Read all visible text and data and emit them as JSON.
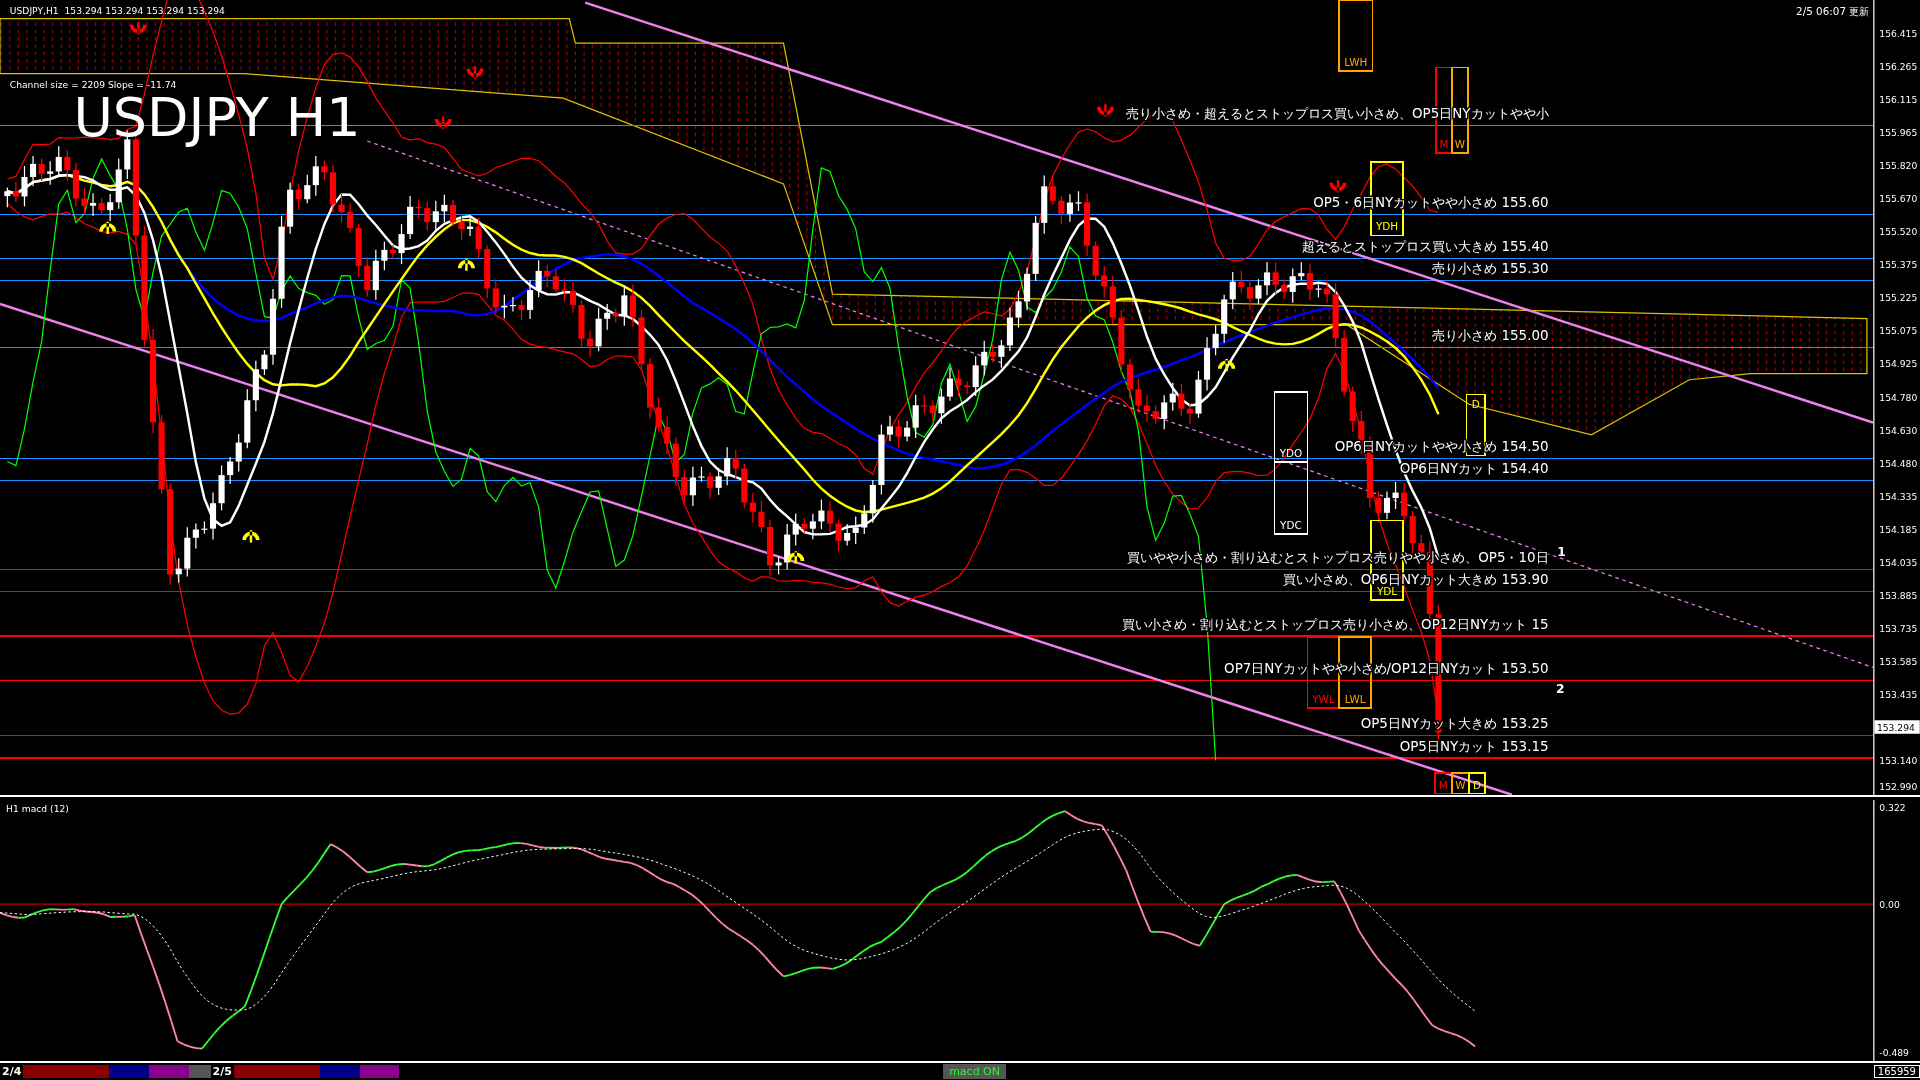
{
  "header": {
    "symbol": "USDJPY,H1",
    "prices": "153.294 153.294 153.294 153.294"
  },
  "channel_info": "Channel size = 2209 Slope = -11.74",
  "title": "USDJPY H1",
  "updated": "2/5 06:07 更新",
  "levels": [
    {
      "text": "売り小さめ・超えるとストップロス買い小さめ、OP5日NYカットやや小",
      "color": "#1e90ff"
    },
    {
      "text": "OP5・6日NYカットやや小さめ 155.60",
      "color": "#1e90ff"
    },
    {
      "text": "超えるとストップロス買い大きめ 155.40",
      "color": "#1e90ff"
    },
    {
      "text": "売り小さめ 155.30",
      "color": "#1e90ff"
    },
    {
      "text": "売り小さめ 155.00",
      "color": "#1e90ff"
    },
    {
      "text": "OP6日NYカットやや小さめ 154.50",
      "color": "#1e90ff"
    },
    {
      "text": "OP6日NYカット 154.40",
      "color": "#1e90ff"
    },
    {
      "text": "買いやや小さめ・割り込むとストップロス売りやや小さめ、OP5・10日",
      "color": "#ff0000"
    },
    {
      "text": "買い小さめ、OP6日NYカット大きめ 153.90",
      "color": "#ff0000"
    },
    {
      "text": "買い小さめ・割り込むとストップロス売り小さめ、OP12日NYカット 15",
      "color": "#ff0000"
    },
    {
      "text": "OP7日NYカットやや小さめ/OP12日NYカット 153.50",
      "color": "#ff0000"
    },
    {
      "text": "OP5日NYカット大きめ 153.25",
      "color": "#ff0000"
    },
    {
      "text": "OP5日NYカット 153.15",
      "color": "#ff0000"
    }
  ],
  "range_boxes": [
    {
      "label": "LWH",
      "color": "#ffa500"
    },
    {
      "label": "M",
      "color": "#ff0000"
    },
    {
      "label": "W",
      "color": "#ffa500"
    },
    {
      "label": "YDH",
      "color": "#ffff00"
    },
    {
      "label": "YDO",
      "color": "#ffffff"
    },
    {
      "label": "YDC",
      "color": "#ffffff"
    },
    {
      "label": "D",
      "color": "#ffff00"
    },
    {
      "label": "YDL",
      "color": "#ffff00"
    },
    {
      "label": "YWL",
      "color": "#ff0000"
    },
    {
      "label": "LWL",
      "color": "#ffa500"
    },
    {
      "label": "M",
      "color": "#ff0000"
    },
    {
      "label": "W",
      "color": "#ffa500"
    },
    {
      "label": "D",
      "color": "#ffff00"
    }
  ],
  "point_labels": [
    "1",
    "2"
  ],
  "price_axis": {
    "ticks": [
      "156.415",
      "156.265",
      "156.115",
      "155.965",
      "155.820",
      "155.670",
      "155.520",
      "155.375",
      "155.225",
      "155.075",
      "154.925",
      "154.780",
      "154.630",
      "154.480",
      "154.335",
      "154.185",
      "154.035",
      "153.885",
      "153.735",
      "153.585",
      "153.435",
      "153.140",
      "152.990"
    ],
    "current": "153.294"
  },
  "macd": {
    "title": "H1  macd (12)",
    "ticks": [
      "0.322",
      "0.00",
      "-0.489"
    ]
  },
  "bottom_bar": {
    "dates": [
      "2/4",
      "2/5"
    ],
    "button": "macd ON",
    "counter": "165959"
  }
}
